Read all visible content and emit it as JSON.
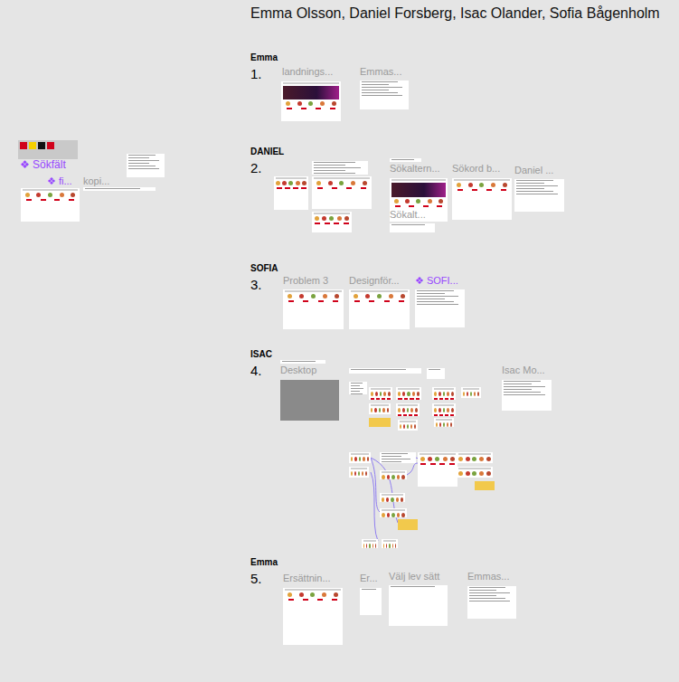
{
  "canvas": {
    "title": "Emma Olsson, Daniel Forsberg, Isac Olander, Sofia Bågenholm"
  },
  "sections": [
    {
      "name": "Emma",
      "number": "1.",
      "frames": [
        {
          "label": "landnings...",
          "kind": "hero",
          "component": false
        },
        {
          "label": "Emmas...",
          "kind": "doc",
          "component": false
        }
      ]
    },
    {
      "name": "DANIEL",
      "number": "2.",
      "frames": [
        {
          "label": "Sökaltern...",
          "kind": "hero",
          "component": false
        },
        {
          "label": "Sökord b...",
          "kind": "page",
          "component": false
        },
        {
          "label": "Daniel ...",
          "kind": "doc",
          "component": false
        },
        {
          "label": "Sökalt...",
          "kind": "plain",
          "component": false
        }
      ]
    },
    {
      "name": "SOFIA",
      "number": "3.",
      "frames": [
        {
          "label": "Problem 3",
          "kind": "page",
          "component": false
        },
        {
          "label": "Designför...",
          "kind": "page",
          "component": false
        },
        {
          "label": "❖ SOFI...",
          "kind": "doc",
          "component": true
        }
      ]
    },
    {
      "name": "ISAC",
      "number": "4.",
      "frames": [
        {
          "label": "Desktop",
          "kind": "gray",
          "component": false
        },
        {
          "label": "Isac Mo...",
          "kind": "doc",
          "component": false
        }
      ]
    },
    {
      "name": "Emma",
      "number": "5.",
      "frames": [
        {
          "label": "Ersättnin...",
          "kind": "page",
          "component": false
        },
        {
          "label": "Er...",
          "kind": "plain",
          "component": false
        },
        {
          "label": "Välj lev sätt",
          "kind": "plain",
          "component": false
        },
        {
          "label": "Emmas...",
          "kind": "doc",
          "component": false
        }
      ]
    }
  ],
  "loose": [
    {
      "label": "❖ Sökfält",
      "component": true
    },
    {
      "label": "❖ fi...",
      "component": true
    },
    {
      "label": "kopi...",
      "component": false
    }
  ]
}
